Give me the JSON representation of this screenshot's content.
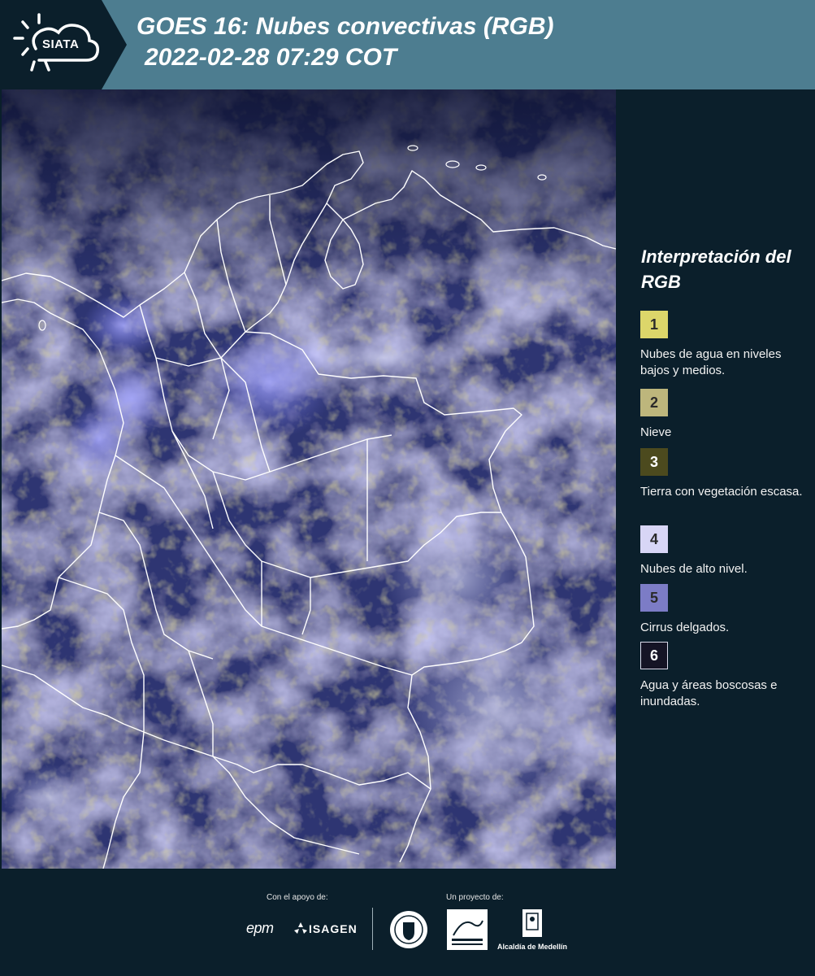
{
  "header": {
    "logo_text": "SIATA",
    "title_line1": "GOES 16: Nubes convectivas (RGB)",
    "title_line2": "2022-02-28 07:29 COT"
  },
  "map": {
    "description_icon": "satellite-rgb-imagery",
    "background_color": "#2b2f66",
    "border_color": "#ffffff"
  },
  "legend": {
    "title": "Interpretación del RGB",
    "items": [
      {
        "number": "1",
        "label": "Nubes de agua en niveles bajos y medios.",
        "color": "#dcd66a"
      },
      {
        "number": "2",
        "label": "Nieve",
        "color": "#bdb67c"
      },
      {
        "number": "3",
        "label": "Tierra con vegetación escasa.",
        "color": "#4c4a1e"
      },
      {
        "number": "4",
        "label": "Nubes de alto nivel.",
        "color": "#d8d6f6"
      },
      {
        "number": "5",
        "label": "Cirrus delgados.",
        "color": "#7c7cc6"
      },
      {
        "number": "6",
        "label": "Agua y áreas boscosas e inundadas.",
        "color": "#151425"
      }
    ]
  },
  "footer": {
    "support_label": "Con el apoyo de:",
    "project_label": "Un proyecto de:",
    "sponsor_epm": "epm",
    "sponsor_isagen": "ISAGEN",
    "alcaldia": "Alcaldía de Medellín"
  }
}
